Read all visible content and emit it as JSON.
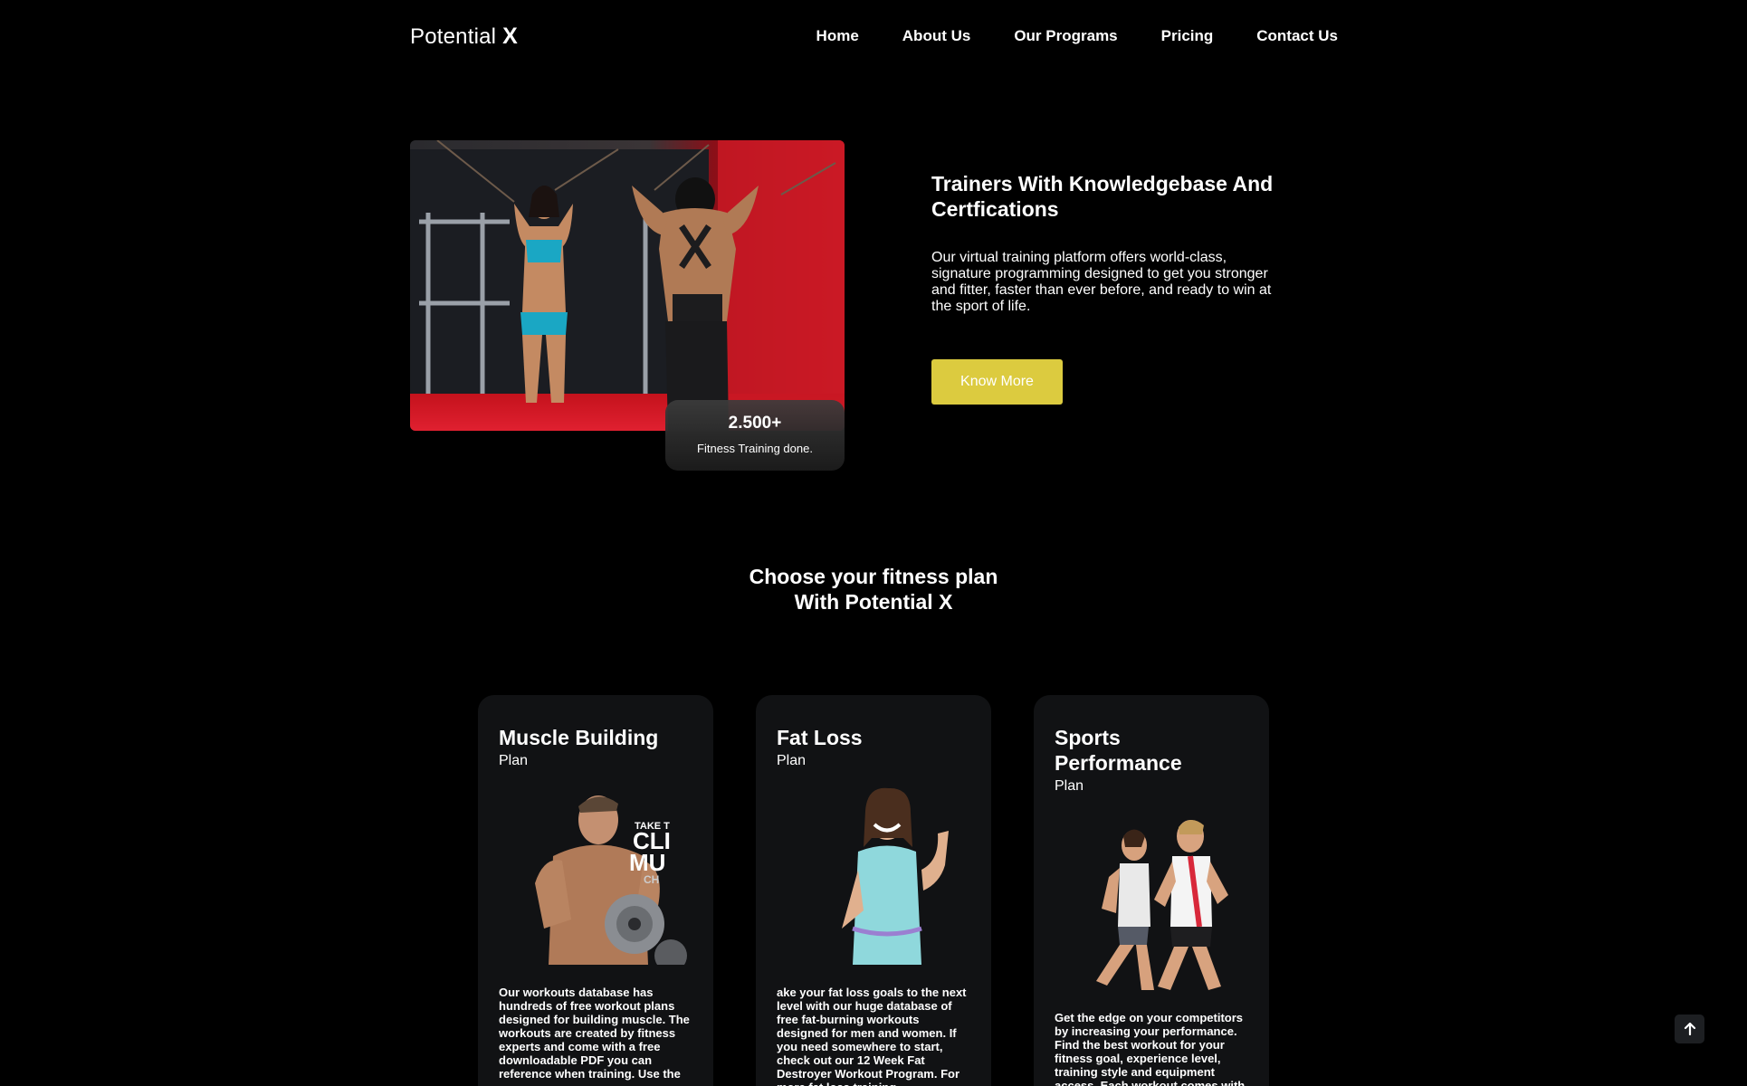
{
  "brand": {
    "name": "Potential",
    "mark": "X"
  },
  "nav": {
    "items": [
      "Home",
      "About Us",
      "Our Programs",
      "Pricing",
      "Contact Us"
    ]
  },
  "hero": {
    "title": "Trainers With Knowledgebase And Certfications",
    "description": "Our virtual training platform offers world-class, signature programming designed to get you stronger and fitter, faster than ever before, and ready to win at the sport of life.",
    "button": "Know More",
    "stat": {
      "value": "2.500+",
      "label": "Fitness Training done."
    },
    "image_alt": "Two female athletes training at cable machine"
  },
  "plans_section": {
    "title_line1": "Choose your fitness plan",
    "title_line2": "With Potential X"
  },
  "plans": [
    {
      "title": "Muscle Building",
      "subtitle": "Plan",
      "text": "Our workouts database has hundreds of free workout plans designed for building muscle. The workouts are created by fitness experts and come with a free downloadable PDF you can reference when training. Use the"
    },
    {
      "title": "Fat Loss",
      "subtitle": "Plan",
      "text": "ake your fat loss goals to the next level with our huge database of free fat-burning workouts designed for men and women. If you need somewhere to start, check out our 12 Week Fat Destroyer Workout Program. For more fat loss training"
    },
    {
      "title": "Sports Performance",
      "subtitle": "Plan",
      "text": "Get the edge on your competitors by increasing your performance. Find the best workout for your fitness goal, experience level, training style and equipment access. Each workout comes with a free"
    }
  ],
  "colors": {
    "accent": "#dccb3f",
    "card_bg": "#111214",
    "background": "#000000"
  },
  "icons": {
    "scroll_top": "arrow-up-icon"
  }
}
